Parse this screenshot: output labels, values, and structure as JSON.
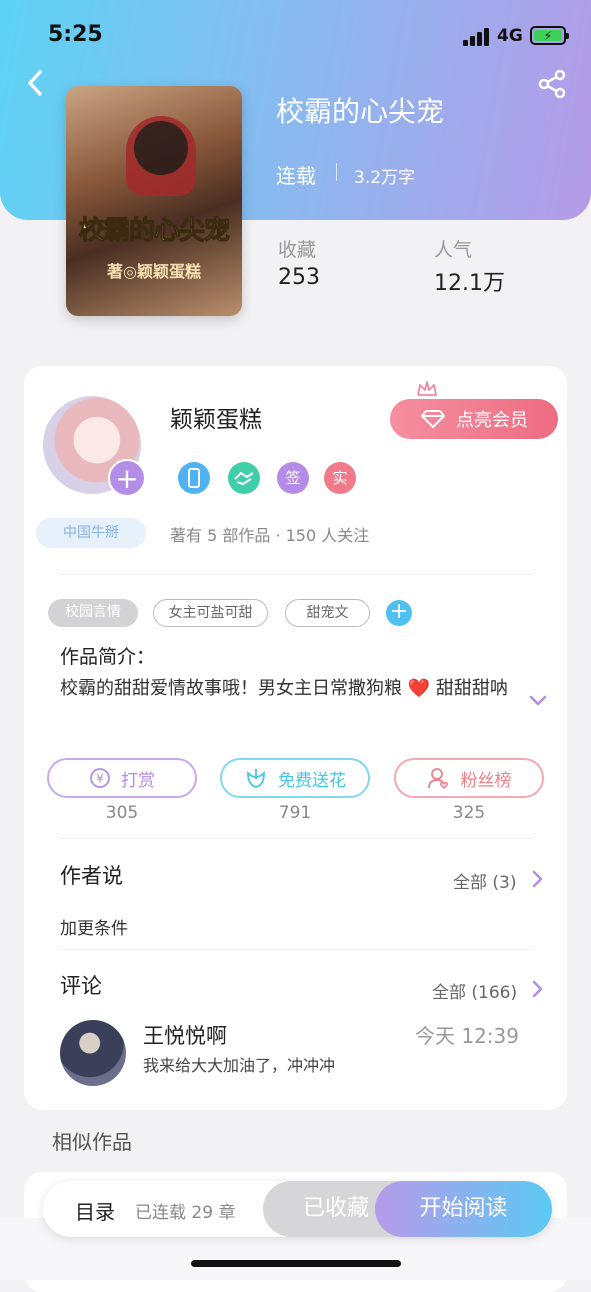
{
  "status_bar": {
    "time": "5:25",
    "network": "4G"
  },
  "book": {
    "title": "校霸的心尖宠",
    "cover_title": "校霸的心尖宠",
    "cover_author": "著◎颖颖蛋糕",
    "status": "连载",
    "word_count": "3.2万字",
    "stats": [
      {
        "label": "收藏",
        "value": "253"
      },
      {
        "label": "人气",
        "value": "12.1万"
      }
    ]
  },
  "author": {
    "name": "颖颖蛋糕",
    "badge": "中国牛掰",
    "vip_label": "点亮会员",
    "medals": [
      {
        "icon": "phone-medal-icon",
        "text": "",
        "color": "#4fb3f2"
      },
      {
        "icon": "handshake-medal-icon",
        "text": "",
        "color": "#3fcfa8"
      },
      {
        "icon": "sign-medal-icon",
        "text": "签",
        "color": "#b48be6"
      },
      {
        "icon": "real-medal-icon",
        "text": "实",
        "color": "#f07a8a"
      }
    ],
    "meta": "著有 5 部作品 · 150 人关注"
  },
  "tags": [
    "校园言情",
    "女主可盐可甜",
    "甜宠文"
  ],
  "intro": {
    "title": "作品简介：",
    "text": "校霸的甜甜爱情故事哦！男女主日常撒狗粮 ❤️ 甜甜甜呐"
  },
  "actions": [
    {
      "label": "打赏",
      "count": "305",
      "icon": "yen-icon",
      "color": "#b48be6"
    },
    {
      "label": "免费送花",
      "count": "791",
      "icon": "flower-icon",
      "color": "#45c6e6"
    },
    {
      "label": "粉丝榜",
      "count": "325",
      "icon": "fan-icon",
      "color": "#ee7f86"
    }
  ],
  "author_says": {
    "title": "作者说",
    "more": "全部 (3)",
    "content": "加更条件"
  },
  "comments": {
    "title": "评论",
    "more": "全部 (166)",
    "items": [
      {
        "user": "王悦悦啊",
        "time": "今天 12:39",
        "text": "我来给大大加油了，冲冲冲"
      }
    ]
  },
  "similar_title": "相似作品",
  "bottom_bar": {
    "toc": "目录",
    "chapters": "已连载 29 章",
    "collected": "已收藏",
    "read": "开始阅读"
  }
}
